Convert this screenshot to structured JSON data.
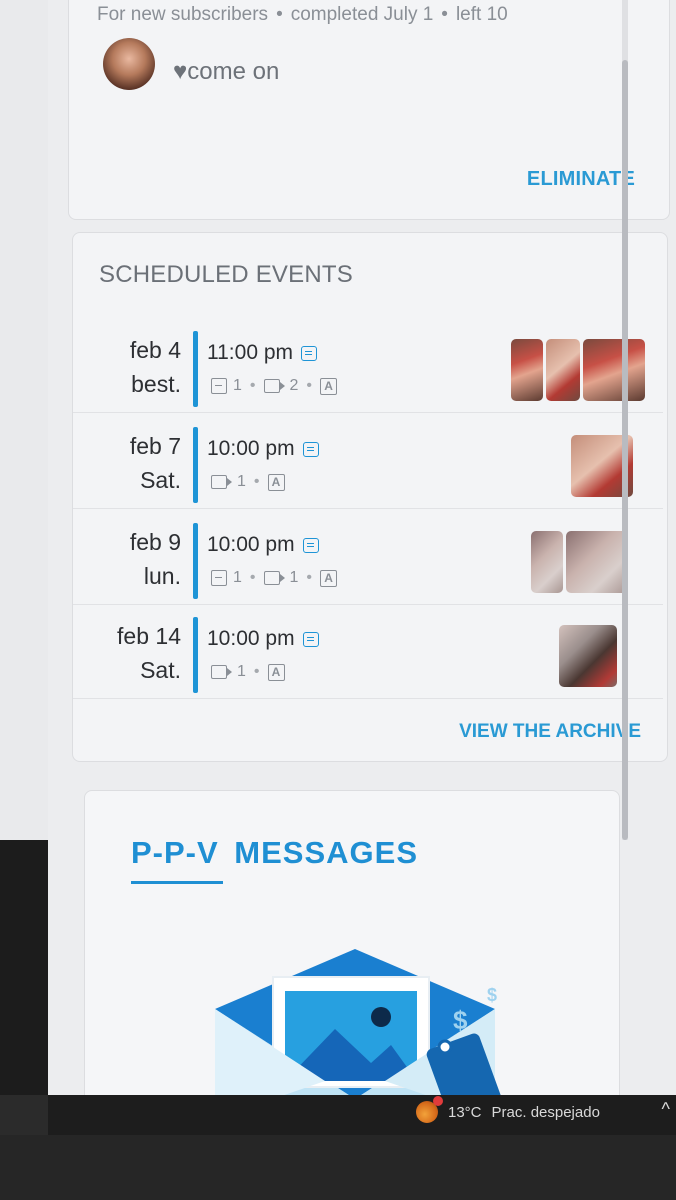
{
  "promo": {
    "audience": "For new subscribers",
    "status": "completed July 1",
    "remaining": "left 10",
    "message": "♥come on",
    "eliminate_label": "ELIMINATE"
  },
  "events": {
    "title": "SCHEDULED EVENTS",
    "items": [
      {
        "date": "feb 4",
        "day": "best.",
        "time": "11:00 pm",
        "photos": "1",
        "videos": "2",
        "has_photos": true
      },
      {
        "date": "feb 7",
        "day": "Sat.",
        "time": "10:00 pm",
        "photos": "",
        "videos": "1",
        "has_photos": false
      },
      {
        "date": "feb 9",
        "day": "lun.",
        "time": "10:00 pm",
        "photos": "1",
        "videos": "1",
        "has_photos": true
      },
      {
        "date": "feb 14",
        "day": "Sat.",
        "time": "10:00 pm",
        "photos": "",
        "videos": "1",
        "has_photos": false
      }
    ],
    "view_archive_label": "VIEW THE ARCHIVE"
  },
  "ppv": {
    "title": "P-P-V  MESSAGES"
  },
  "taskbar": {
    "temperature": "13°C",
    "condition": "Prac. despejado",
    "chevron": "^"
  },
  "colors": {
    "accent": "#1f8fd3",
    "bar": "#1e94d6"
  },
  "icons": [
    "note-icon",
    "photo-icon",
    "video-icon",
    "auto-icon",
    "weather-icon",
    "chevron-up-icon"
  ]
}
